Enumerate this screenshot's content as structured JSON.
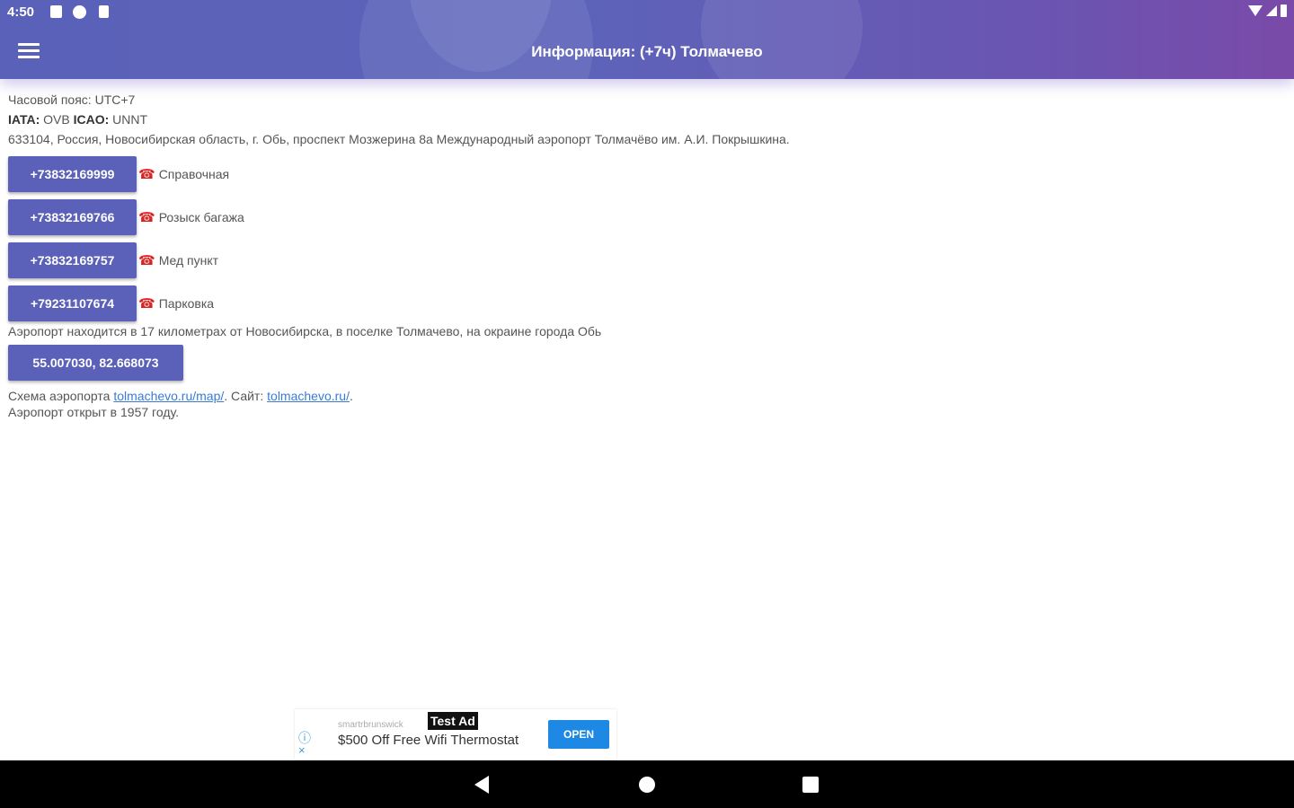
{
  "status_bar": {
    "time": "4:50",
    "icons_left": [
      "notification-icon",
      "app-p-icon",
      "sd-card-icon"
    ],
    "icons_right": [
      "wifi-icon",
      "signal-icon",
      "battery-icon"
    ]
  },
  "app_bar": {
    "title": "Информация: (+7ч) Толмачево",
    "menu_icon": "hamburger-menu-icon"
  },
  "info": {
    "timezone_label": "Часовой пояс:",
    "timezone_value": "UTC+7",
    "iata_label": "IATA:",
    "iata_value": "OVB",
    "icao_label": "ICAO:",
    "icao_value": "UNNT",
    "address": "633104, Россия, Новосибирская область, г. Обь, проспект Мозжерина 8а Международный аэропорт Толмачёво им. А.И. Покрышкина."
  },
  "phones": [
    {
      "number": "+73832169999",
      "description": "Справочная"
    },
    {
      "number": "+73832169766",
      "description": "Розыск багажа"
    },
    {
      "number": "+73832169757",
      "description": "Мед пункт"
    },
    {
      "number": "+79231107674",
      "description": "Парковка"
    }
  ],
  "location_text": "Аэропорт находится в 17 километрах от Новосибирска, в поселке Толмачево, на окраине города Обь",
  "coordinates_button": "55.007030, 82.668073",
  "scheme": {
    "label": "Схема аэропорта",
    "map_link": "tolmachevo.ru/map/",
    "site_label": ". Сайт:",
    "site_link": "tolmachevo.ru/",
    "end": "."
  },
  "opened_text": "Аэропорт открыт в 1957 году.",
  "ad": {
    "advertiser": "smartrbrunswick",
    "badge": "Test Ad",
    "text": "$500 Off Free Wifi Thermostat",
    "cta": "OPEN",
    "info_symbol": "ⓘ",
    "close_symbol": "×"
  },
  "colors": {
    "accent": "#5b61b9",
    "link": "#3a7bd5",
    "phone_icon": "#dd2222",
    "ad_cta": "#1e88e5"
  }
}
